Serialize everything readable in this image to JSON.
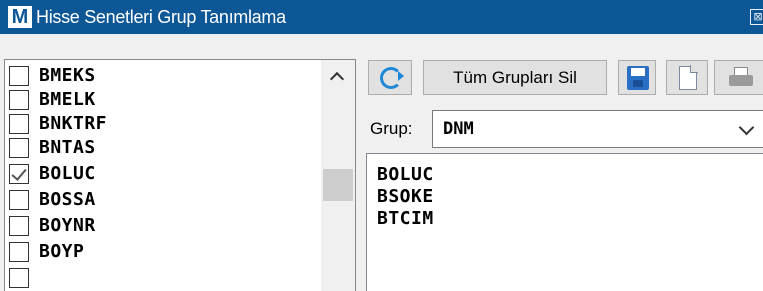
{
  "window": {
    "logo_letter": "M",
    "title": "Hisse Senetleri Grup Tanımlama",
    "close_glyph": "⊠"
  },
  "stock_list": {
    "items": [
      {
        "code": "BMEKS",
        "checked": false
      },
      {
        "code": "BMELK",
        "checked": false
      },
      {
        "code": "BNKTRF",
        "checked": false
      },
      {
        "code": "BNTAS",
        "checked": false
      },
      {
        "code": "BOLUC",
        "checked": true
      },
      {
        "code": "BOSSA",
        "checked": false
      },
      {
        "code": "BOYNR",
        "checked": false
      },
      {
        "code": "BOYP",
        "checked": false
      }
    ]
  },
  "toolbar": {
    "clear_all_label": "Tüm Grupları Sil",
    "icons": [
      "refresh-icon",
      "save-icon",
      "new-document-icon",
      "print-icon"
    ]
  },
  "group": {
    "label": "Grup:",
    "selected": "DNM"
  },
  "members": [
    "BOLUC",
    "BSOKE",
    "BTCIM"
  ],
  "colors": {
    "titlebar": "#0d5796",
    "accent_blue": "#1e88d6"
  }
}
